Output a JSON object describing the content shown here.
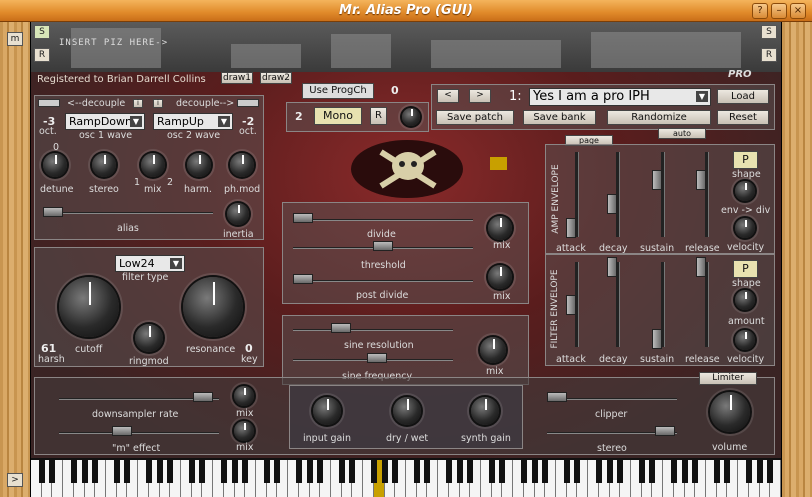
{
  "window": {
    "title": "Mr. Alias Pro (GUI)",
    "buttons": [
      "?",
      "–",
      "×"
    ]
  },
  "side": {
    "m": "m",
    "s": "S",
    "r": "R",
    "expand": ">"
  },
  "header": {
    "insert_text": "INSERT PIZ HERE->",
    "pro": "PRO",
    "registered": "Registered to Brian Darrell Collins",
    "draw1": "draw1",
    "draw2": "draw2"
  },
  "prog": {
    "use_progch": "Use ProgCh",
    "prog_value": "0",
    "voices": "2",
    "mono": "Mono",
    "r": "R"
  },
  "patch": {
    "prev": "<",
    "next": ">",
    "number": "1:",
    "name": "Yes I am a pro IPH",
    "load": "Load",
    "save_patch": "Save patch",
    "save_bank": "Save bank",
    "randomize": "Randomize",
    "reset": "Reset",
    "auto": "auto",
    "page": "page"
  },
  "osc": {
    "decouple_left": "<--decouple",
    "decouple_right": "decouple-->",
    "i": "i",
    "oct1": "-3",
    "oct2": "-2",
    "oct_label": "oct.",
    "osc1_wave": "RampDown",
    "osc2_wave": "RampUp",
    "osc1_label": "osc 1 wave",
    "osc2_label": "osc 2 wave",
    "detune_label": "detune",
    "detune_zero": "0",
    "stereo_label": "stereo",
    "mix_label": "mix",
    "mix_1": "1",
    "mix_2": "2",
    "harm_label": "harm.",
    "phmod_label": "ph.mod",
    "alias_label": "alias",
    "inertia_label": "inertia"
  },
  "filter": {
    "type_value": "Low24",
    "type_label": "filter type",
    "cutoff_label": "cutoff",
    "ringmod_label": "ringmod",
    "resonance_label": "resonance",
    "harsh_value": "61",
    "harsh_label": "harsh",
    "key_value": "0",
    "key_label": "key"
  },
  "divide": {
    "divide_label": "divide",
    "threshold_label": "threshold",
    "post_divide_label": "post divide",
    "mix1": "mix",
    "mix2": "mix"
  },
  "sine": {
    "resolution_label": "sine resolution",
    "frequency_label": "sine frequency",
    "mix": "mix"
  },
  "amp_env": {
    "title": "AMP ENVELOPE",
    "attack": "attack",
    "decay": "decay",
    "sustain": "sustain",
    "release": "release",
    "p": "P",
    "shape": "shape",
    "env_div": "env -> div",
    "velocity": "velocity"
  },
  "filter_env": {
    "title": "FILTER ENVELOPE",
    "attack": "attack",
    "decay": "decay",
    "sustain": "sustain",
    "release": "release",
    "p": "P",
    "shape": "shape",
    "amount": "amount",
    "velocity": "velocity"
  },
  "bottom": {
    "downsampler": "downsampler rate",
    "m_effect": "\"m\" effect",
    "mix1": "mix",
    "mix2": "mix",
    "input_gain": "input gain",
    "dry_wet": "dry / wet",
    "synth_gain": "synth gain",
    "limiter": "Limiter",
    "clipper": "clipper",
    "stereo": "stereo",
    "volume": "volume"
  },
  "colors": {
    "accent": "#c8a000",
    "title_bar": "#e08a2a",
    "panel_border": "#8b8585"
  }
}
